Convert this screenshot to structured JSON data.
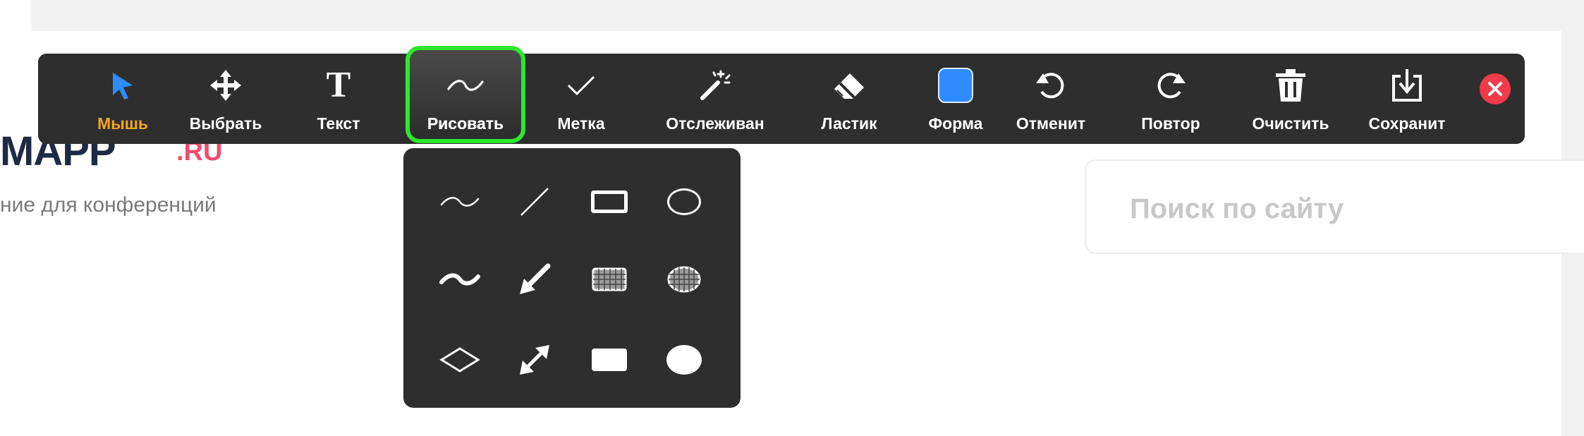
{
  "page": {
    "logo_main": "MAPP",
    "logo_suffix": ".RU",
    "tagline": "ние для конференций",
    "search_placeholder": "Поиск по сайту"
  },
  "toolbar": {
    "tools": [
      {
        "label": "Мышь",
        "icon": "mouse-pointer-icon",
        "active": true
      },
      {
        "label": "Выбрать",
        "icon": "move-icon"
      },
      {
        "label": "Текст",
        "icon": "text-icon"
      },
      {
        "label": "Рисовать",
        "icon": "draw-wave-icon",
        "selected": true
      },
      {
        "label": "Метка",
        "icon": "checkmark-icon"
      },
      {
        "label": "Отслеживан",
        "icon": "magic-wand-icon"
      },
      {
        "label": "Ластик",
        "icon": "eraser-icon"
      },
      {
        "label": "Форма",
        "icon": "shape-square-icon"
      },
      {
        "label": "Отменит",
        "icon": "undo-icon"
      },
      {
        "label": "Повтор",
        "icon": "redo-icon"
      },
      {
        "label": "Очистить",
        "icon": "trash-icon"
      },
      {
        "label": "Сохранит",
        "icon": "save-icon"
      }
    ],
    "close_icon": "close-icon"
  },
  "draw_menu": {
    "items": [
      "squiggle-thin-icon",
      "line-icon",
      "rectangle-outline-icon",
      "ellipse-outline-icon",
      "squiggle-thick-icon",
      "arrow-icon",
      "rectangle-semi-transparent-icon",
      "ellipse-semi-transparent-icon",
      "diamond-outline-icon",
      "double-arrow-icon",
      "rectangle-filled-icon",
      "ellipse-filled-icon"
    ]
  },
  "colors": {
    "toolbar_bg": "#2e2e2e",
    "active_label": "#f5a623",
    "selected_border": "#2ee62e",
    "shape_fill": "#2f8cff",
    "close": "#ef3b4a",
    "logo_accent": "#f04b6e"
  }
}
